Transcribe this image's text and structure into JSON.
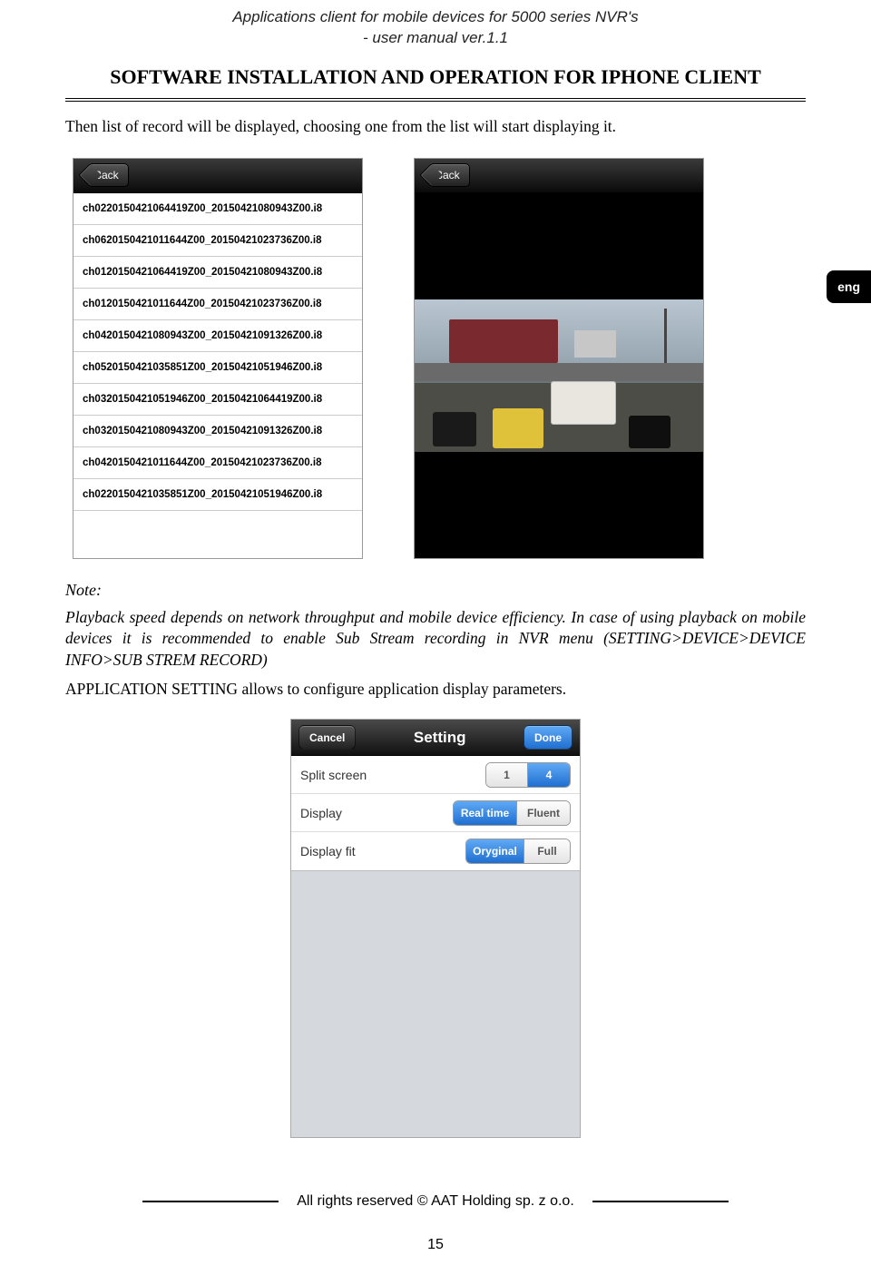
{
  "doc": {
    "header_line1": "Applications client for mobile devices for 5000 series NVR's",
    "header_line2": "- user manual ver.1.1",
    "section_title": "SOFTWARE INSTALLATION AND OPERATION FOR IPHONE CLIENT",
    "intro": "Then list of record will be displayed, choosing one from the list will start displaying it.",
    "note_label": "Note:",
    "note_body": "Playback speed depends on network throughput and mobile device efficiency. In case of using playback on mobile devices it is recommended to enable  Sub Stream recording  in NVR menu (SETTING>DEVICE>DEVICE INFO>SUB STREM RECORD)",
    "app_setting_line": "APPLICATION SETTING allows to configure application display parameters.",
    "footer": "All rights reserved © AAT Holding sp. z o.o.",
    "page_number": "15",
    "lang_tab": "eng"
  },
  "record_list": {
    "back_label": "Back",
    "items": [
      "ch0220150421064419Z00_20150421080943Z00.i8",
      "ch0620150421011644Z00_20150421023736Z00.i8",
      "ch0120150421064419Z00_20150421080943Z00.i8",
      "ch0120150421011644Z00_20150421023736Z00.i8",
      "ch0420150421080943Z00_20150421091326Z00.i8",
      "ch0520150421035851Z00_20150421051946Z00.i8",
      "ch0320150421051946Z00_20150421064419Z00.i8",
      "ch0320150421080943Z00_20150421091326Z00.i8",
      "ch0420150421011644Z00_20150421023736Z00.i8",
      "ch0220150421035851Z00_20150421051946Z00.i8"
    ]
  },
  "playback": {
    "back_label": "Back"
  },
  "setting": {
    "cancel": "Cancel",
    "title": "Setting",
    "done": "Done",
    "rows": {
      "split": {
        "label": "Split screen",
        "opt1": "1",
        "opt2": "4",
        "selected": 2
      },
      "display": {
        "label": "Display",
        "opt1": "Real time",
        "opt2": "Fluent",
        "selected": 1
      },
      "fit": {
        "label": "Display fit",
        "opt1": "Oryginal",
        "opt2": "Full",
        "selected": 1
      }
    }
  }
}
